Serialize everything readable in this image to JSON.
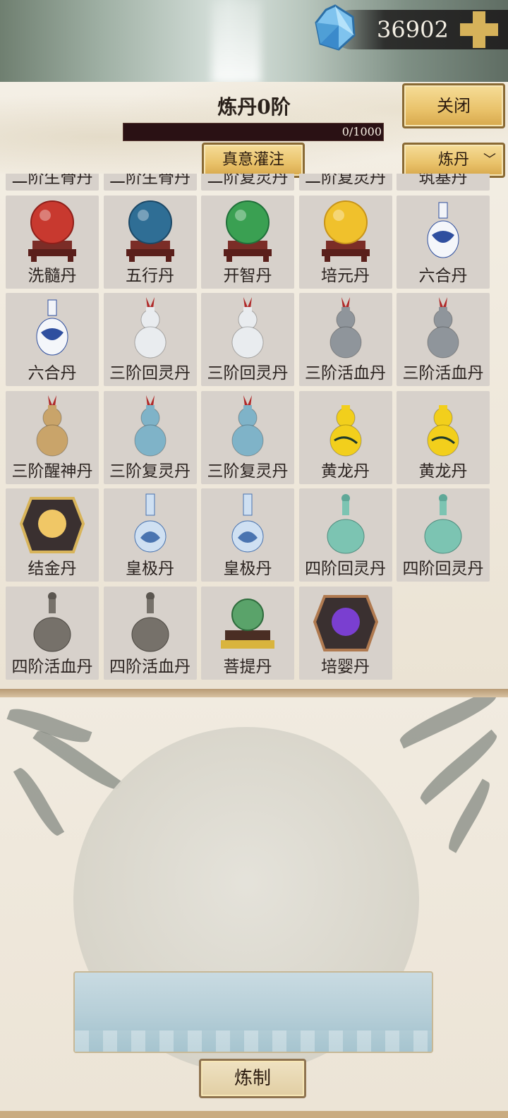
{
  "header": {
    "currency_value": "36902"
  },
  "panel": {
    "title": "炼丹0阶",
    "progress_text": "0/1000",
    "progress_fraction": 0.0,
    "close_label": "关闭",
    "infuse_label": "真意灌注",
    "type_select": {
      "selected": "炼丹"
    }
  },
  "pills": [
    {
      "name": "二阶生骨丹",
      "icon": "gourd-bottle"
    },
    {
      "name": "二阶生骨丹",
      "icon": "gourd-bottle"
    },
    {
      "name": "二阶复灵丹",
      "icon": "gourd-bottle"
    },
    {
      "name": "二阶复灵丹",
      "icon": "gourd-bottle"
    },
    {
      "name": "筑基丹",
      "icon": "vase"
    },
    {
      "name": "洗髓丹",
      "icon": "red-orb-stand"
    },
    {
      "name": "五行丹",
      "icon": "blue-orb-stand"
    },
    {
      "name": "开智丹",
      "icon": "green-orb-stand"
    },
    {
      "name": "培元丹",
      "icon": "yellow-orb-stand"
    },
    {
      "name": "六合丹",
      "icon": "blue-white-vase"
    },
    {
      "name": "六合丹",
      "icon": "blue-white-vase"
    },
    {
      "name": "三阶回灵丹",
      "icon": "white-gourd"
    },
    {
      "name": "三阶回灵丹",
      "icon": "white-gourd"
    },
    {
      "name": "三阶活血丹",
      "icon": "gray-gourd"
    },
    {
      "name": "三阶活血丹",
      "icon": "gray-gourd"
    },
    {
      "name": "三阶醒神丹",
      "icon": "tan-gourd"
    },
    {
      "name": "三阶复灵丹",
      "icon": "blue-gourd"
    },
    {
      "name": "三阶复灵丹",
      "icon": "blue-gourd"
    },
    {
      "name": "黄龙丹",
      "icon": "yellow-dragon-gourd"
    },
    {
      "name": "黄龙丹",
      "icon": "yellow-dragon-gourd"
    },
    {
      "name": "结金丹",
      "icon": "golden-pearl-box"
    },
    {
      "name": "皇极丹",
      "icon": "lotus-vase"
    },
    {
      "name": "皇极丹",
      "icon": "lotus-vase"
    },
    {
      "name": "四阶回灵丹",
      "icon": "celadon-bottle"
    },
    {
      "name": "四阶回灵丹",
      "icon": "celadon-bottle"
    },
    {
      "name": "四阶活血丹",
      "icon": "gray-bottle"
    },
    {
      "name": "四阶活血丹",
      "icon": "gray-bottle"
    },
    {
      "name": "菩提丹",
      "icon": "green-orb-gold-stand"
    },
    {
      "name": "培婴丹",
      "icon": "purple-pearl-box"
    }
  ],
  "refine": {
    "button_label": "炼制"
  },
  "colors": {
    "gold": "#e9c26a",
    "progress_bg": "#2a1114",
    "cell_bg": "#d7d1cb"
  }
}
